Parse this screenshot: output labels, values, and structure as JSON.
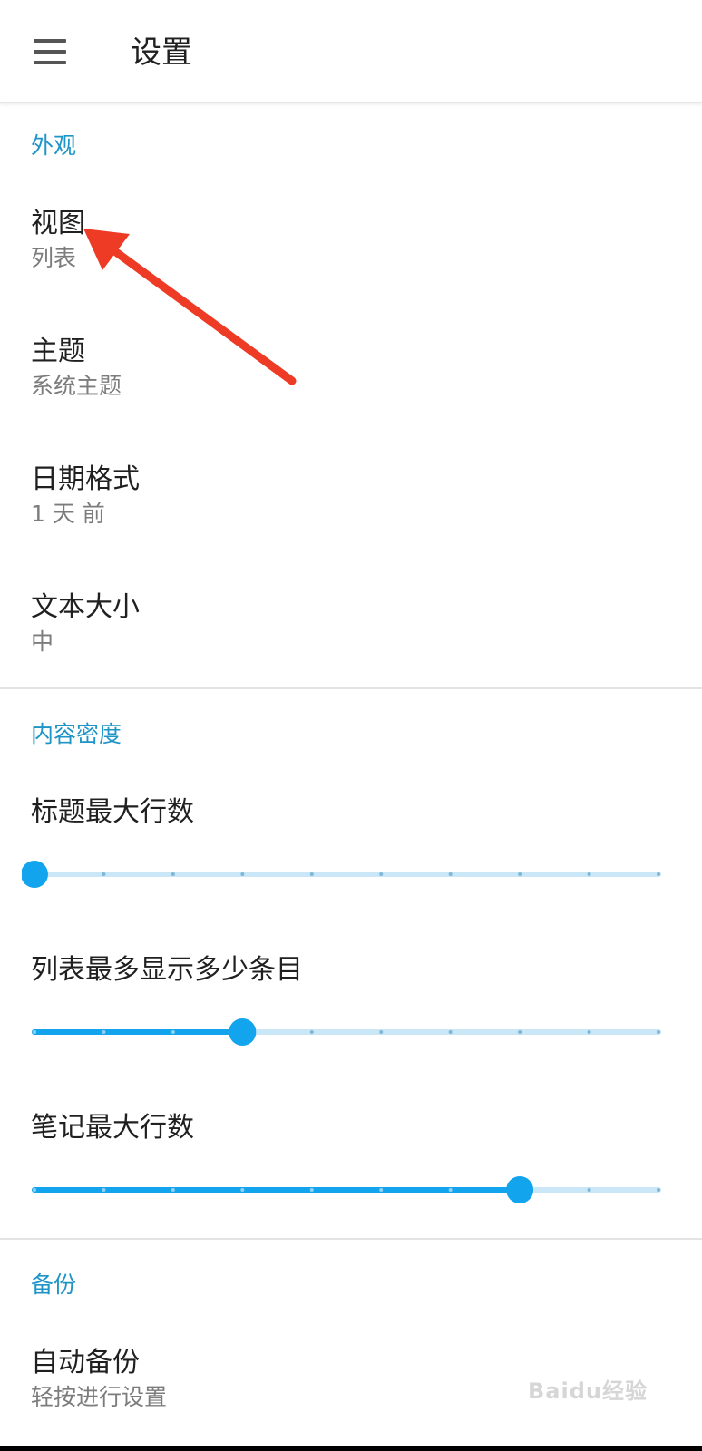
{
  "app_bar": {
    "title": "设置",
    "menu_icon": "hamburger-menu-icon"
  },
  "appearance": {
    "header": "外观",
    "items": [
      {
        "title": "视图",
        "value": "列表"
      },
      {
        "title": "主题",
        "value": "系统主题"
      },
      {
        "title": "日期格式",
        "value": "1 天 前"
      },
      {
        "title": "文本大小",
        "value": "中"
      }
    ]
  },
  "content_density": {
    "header": "内容密度",
    "sliders": [
      {
        "label": "标题最大行数",
        "steps": 10,
        "value_step": 0
      },
      {
        "label": "列表最多显示多少条目",
        "steps": 10,
        "value_step": 3
      },
      {
        "label": "笔记最大行数",
        "steps": 10,
        "value_step": 7
      }
    ]
  },
  "backup": {
    "header": "备份",
    "items": [
      {
        "title": "自动备份",
        "value": "轻按进行设置"
      }
    ]
  },
  "watermark": {
    "text": "Baidu经验"
  },
  "colors": {
    "accent": "#1e95c6",
    "slider_active": "#13a4ee",
    "slider_track": "#cae7f7",
    "annotation_arrow": "#ee3b25"
  }
}
